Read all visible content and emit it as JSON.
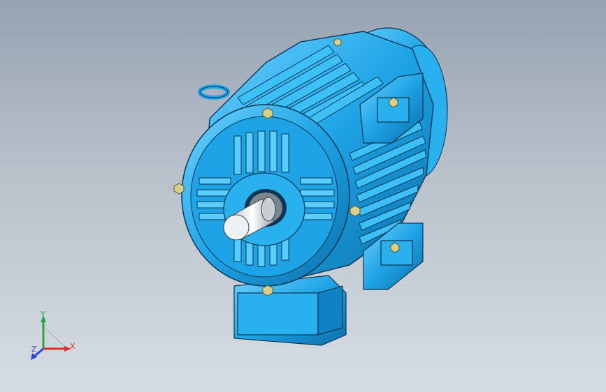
{
  "viewport": {
    "background_top": "#97a3b2",
    "background_bottom": "#d7dde4"
  },
  "model": {
    "body_color": "#1ea3e6",
    "highlight_color": "#6fd2ff",
    "shadow_color": "#0b6fa8",
    "outline_color": "#0a3552",
    "bolt_color": "#d9d08a",
    "shaft_color": "#e9ecef"
  },
  "triad": {
    "x_label": "X",
    "y_label": "Y",
    "z_label": "Z",
    "x_color": "#d8312a",
    "y_color": "#2ea44a",
    "z_color": "#2a45d8"
  }
}
